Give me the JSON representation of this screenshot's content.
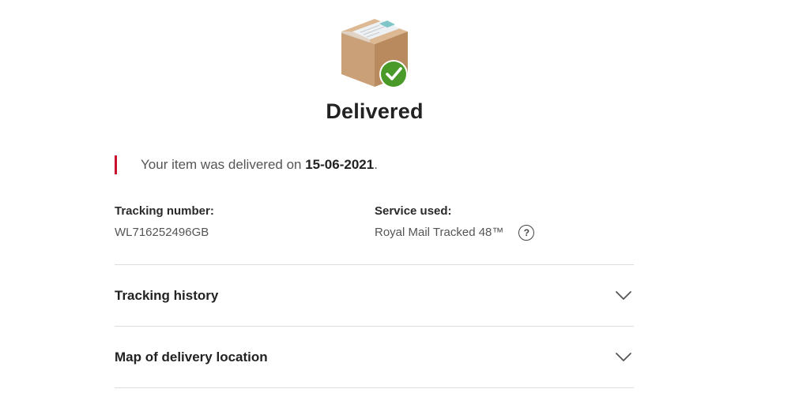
{
  "status": {
    "heading": "Delivered",
    "icon": "parcel-delivered-icon",
    "check_color": "#4a9a2a"
  },
  "notice": {
    "prefix": "Your item was delivered on ",
    "date": "15-06-2021",
    "suffix": ".",
    "accent_color": "#c8102e"
  },
  "tracking": {
    "label": "Tracking number:",
    "value": "WL716252496GB"
  },
  "service": {
    "label": "Service used:",
    "value": "Royal Mail Tracked 48™",
    "help_icon": "?"
  },
  "accordion": {
    "items": [
      {
        "label": "Tracking history",
        "icon": "chevron-down-icon"
      },
      {
        "label": "Map of delivery location",
        "icon": "chevron-down-icon"
      }
    ]
  }
}
